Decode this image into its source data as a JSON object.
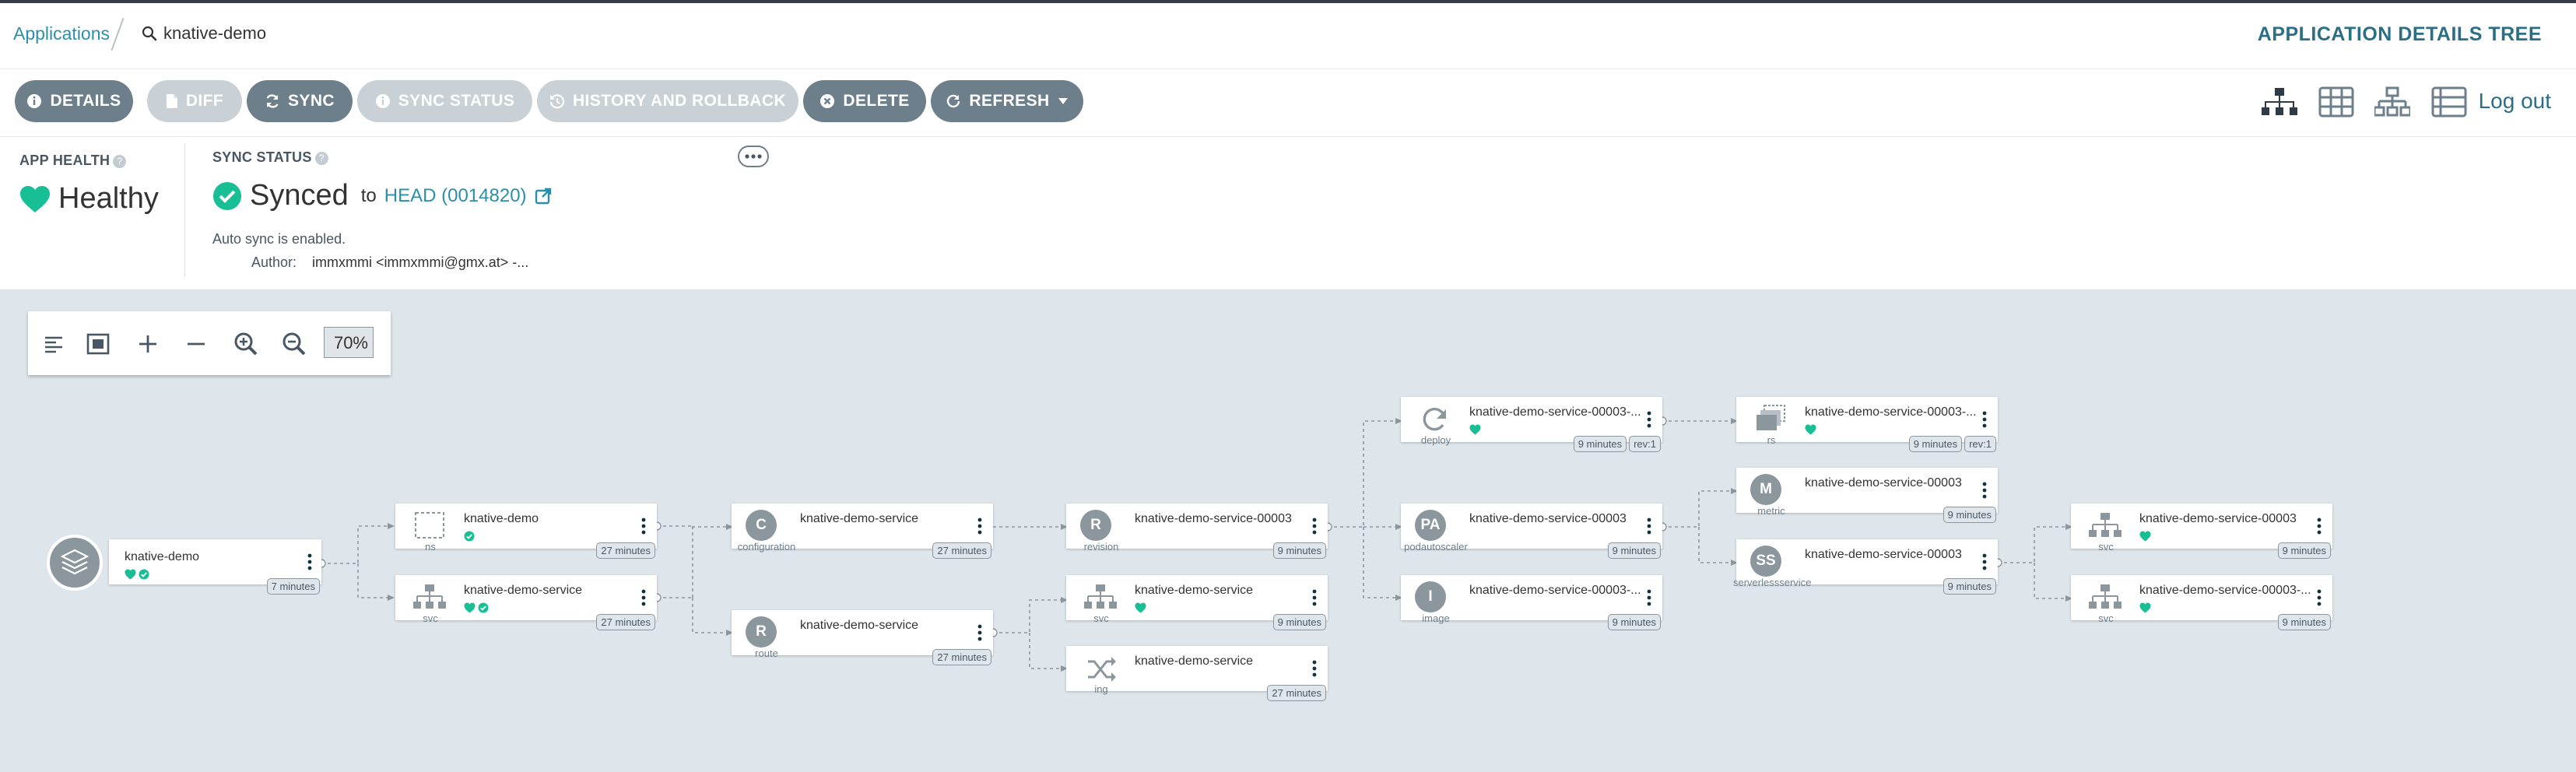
{
  "breadcrumb": {
    "root": "Applications",
    "current": "knative-demo"
  },
  "page_title": "APPLICATION DETAILS TREE",
  "toolbar": {
    "details": "DETAILS",
    "diff": "DIFF",
    "sync": "SYNC",
    "sync_status": "SYNC STATUS",
    "history": "HISTORY AND ROLLBACK",
    "delete": "DELETE",
    "refresh": "REFRESH",
    "logout": "Log out"
  },
  "app_health": {
    "label": "APP HEALTH",
    "value": "Healthy"
  },
  "sync_status": {
    "label": "SYNC STATUS",
    "value": "Synced",
    "to": "to",
    "revision": "HEAD (0014820)",
    "auto_sync": "Auto sync is enabled.",
    "author_label": "Author:",
    "author": "immxmmi <immxmmi@gmx.at> -..."
  },
  "zoom": {
    "value": "70%"
  },
  "nodes": [
    {
      "id": "app",
      "name": "knative-demo",
      "kind": "",
      "age": "7 minutes",
      "rev": ""
    },
    {
      "id": "ns",
      "name": "knative-demo",
      "kind": "ns",
      "age": "27 minutes",
      "rev": ""
    },
    {
      "id": "svc1",
      "name": "knative-demo-service",
      "kind": "svc",
      "age": "27 minutes",
      "rev": ""
    },
    {
      "id": "config",
      "name": "knative-demo-service",
      "kind": "configuration",
      "age": "27 minutes",
      "rev": "",
      "letter": "C"
    },
    {
      "id": "route",
      "name": "knative-demo-service",
      "kind": "route",
      "age": "27 minutes",
      "rev": "",
      "letter": "R"
    },
    {
      "id": "revision",
      "name": "knative-demo-service-00003",
      "kind": "revision",
      "age": "9 minutes",
      "rev": "",
      "letter": "R"
    },
    {
      "id": "svc2",
      "name": "knative-demo-service",
      "kind": "svc",
      "age": "9 minutes",
      "rev": ""
    },
    {
      "id": "ing",
      "name": "knative-demo-service",
      "kind": "ing",
      "age": "27 minutes",
      "rev": ""
    },
    {
      "id": "deploy",
      "name": "knative-demo-service-00003-...",
      "kind": "deploy",
      "age": "9 minutes",
      "rev": "rev:1"
    },
    {
      "id": "pa",
      "name": "knative-demo-service-00003",
      "kind": "podautoscaler",
      "age": "9 minutes",
      "rev": "",
      "letter": "PA"
    },
    {
      "id": "image",
      "name": "knative-demo-service-00003-...",
      "kind": "image",
      "age": "9 minutes",
      "rev": "",
      "letter": "I"
    },
    {
      "id": "rs",
      "name": "knative-demo-service-00003-...",
      "kind": "rs",
      "age": "9 minutes",
      "rev": "rev:1"
    },
    {
      "id": "metric",
      "name": "knative-demo-service-00003",
      "kind": "metric",
      "age": "9 minutes",
      "rev": "",
      "letter": "M"
    },
    {
      "id": "sks",
      "name": "knative-demo-service-00003",
      "kind": "serverlessservice",
      "age": "9 minutes",
      "rev": "",
      "letter": "SS"
    },
    {
      "id": "svc3",
      "name": "knative-demo-service-00003",
      "kind": "svc",
      "age": "9 minutes",
      "rev": ""
    },
    {
      "id": "svc4",
      "name": "knative-demo-service-00003-...",
      "kind": "svc",
      "age": "9 minutes",
      "rev": ""
    }
  ],
  "colors": {
    "accent": "#2b8fa9",
    "healthy": "#18be94",
    "button": "#6d7f8b",
    "button_disabled": "#c9d1d6",
    "canvas": "#dee6eb"
  }
}
